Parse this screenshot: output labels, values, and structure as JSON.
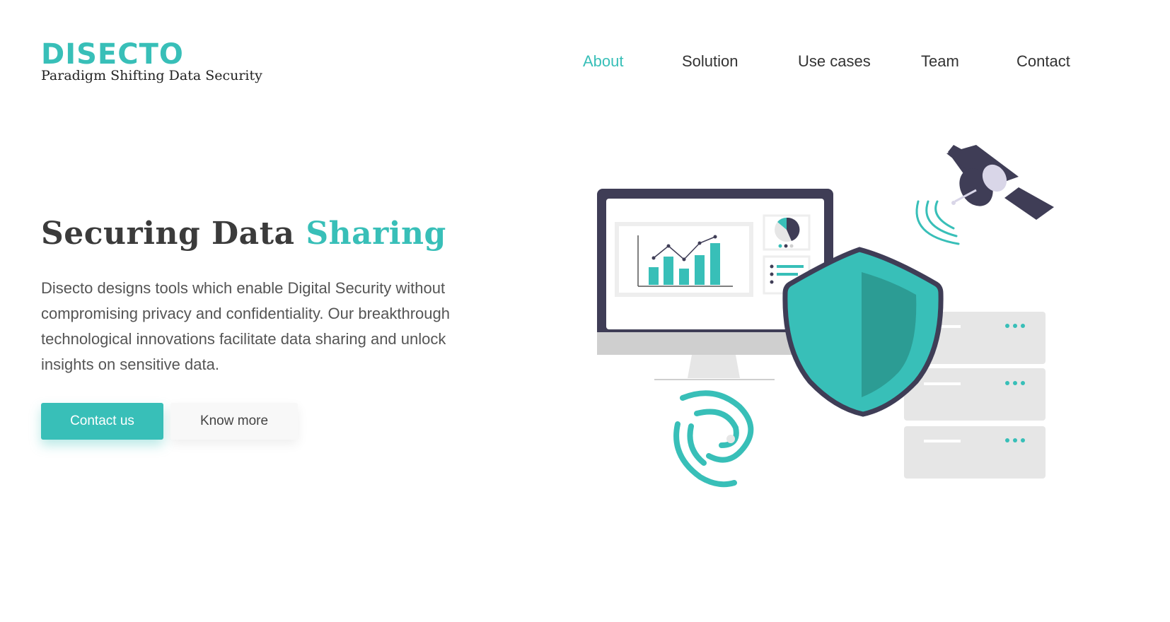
{
  "brand": {
    "name": "DISECTO",
    "tagline": "Paradigm Shifting Data Security"
  },
  "nav": {
    "items": [
      {
        "label": "About",
        "active": true
      },
      {
        "label": "Solution",
        "active": false
      },
      {
        "label": "Use cases",
        "active": false
      },
      {
        "label": "Team",
        "active": false
      },
      {
        "label": "Contact",
        "active": false
      }
    ]
  },
  "hero": {
    "title_main": "Securing Data ",
    "title_accent": "Sharing",
    "description": "Disecto designs tools which enable Digital Security without compromising privacy and confidentiality. Our breakthrough technological innovations facilitate data sharing and unlock insights on sensitive data.",
    "primary_button": "Contact us",
    "secondary_button": "Know more"
  },
  "illustration": {
    "icons": [
      "monitor-icon",
      "bar-chart-icon",
      "pie-chart-icon",
      "shield-icon",
      "satellite-icon",
      "signal-waves-icon",
      "server-stack-icon",
      "fingerprint-icon"
    ]
  },
  "colors": {
    "accent": "#38bfb8",
    "accent_dark": "#2c9c94",
    "ink": "#3f3d56",
    "text": "#3b3b3b",
    "muted": "#e6e6e6"
  }
}
